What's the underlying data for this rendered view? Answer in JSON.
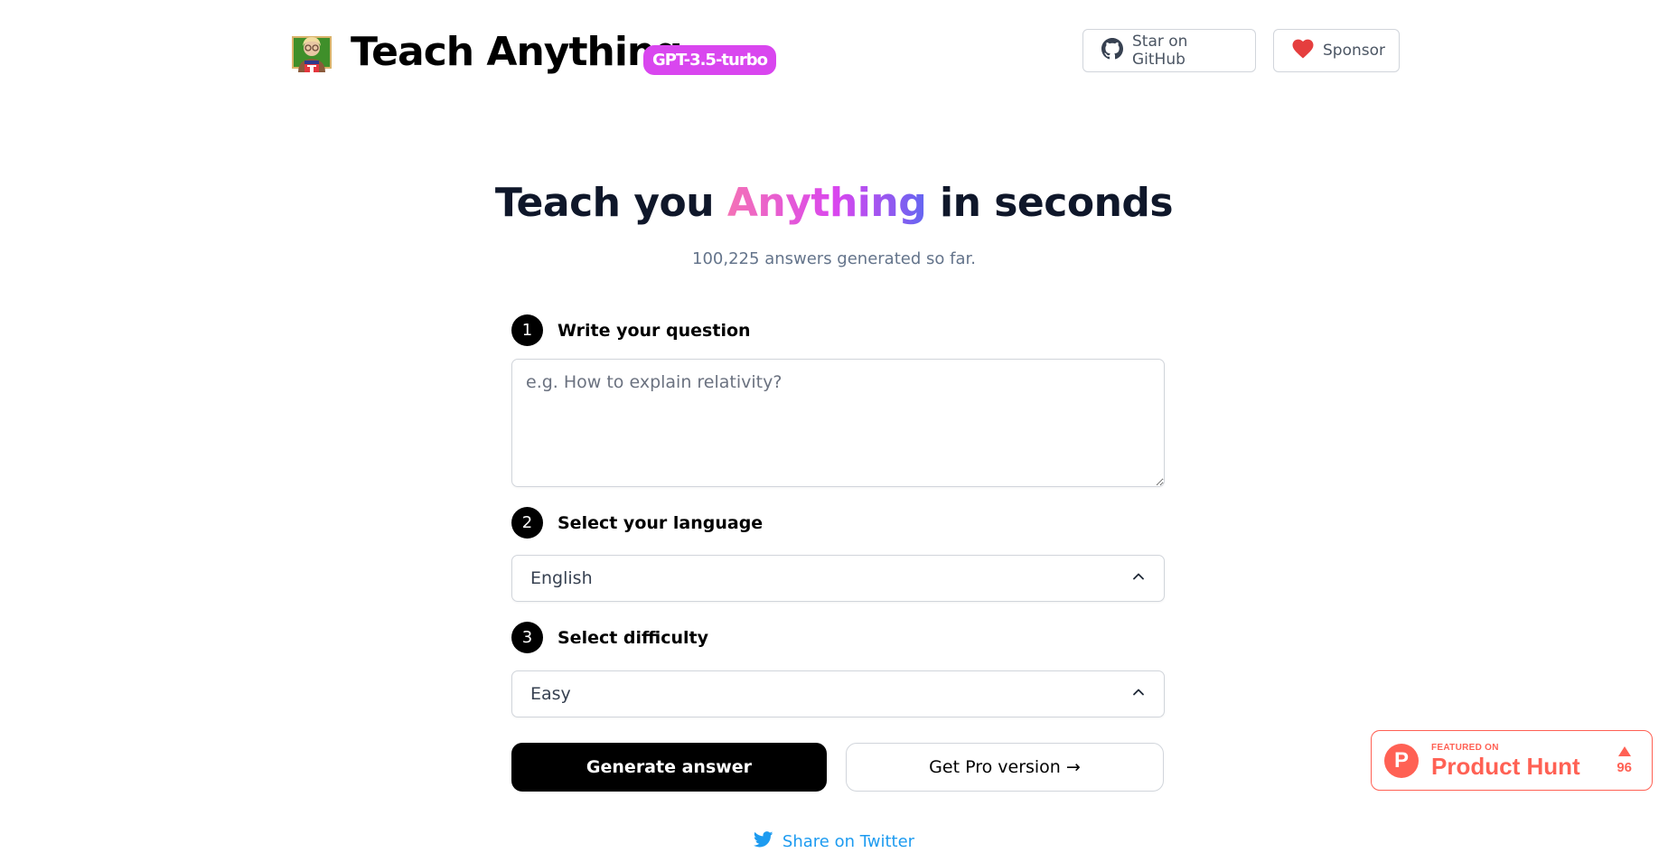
{
  "header": {
    "logo_icon": "teacher-emoji-icon",
    "app_title": "Teach Anything",
    "model_badge": "GPT-3.5-turbo",
    "github_button": {
      "icon": "github-icon",
      "label": "Star on GitHub"
    },
    "sponsor_button": {
      "icon": "heart-icon",
      "label": "Sponsor"
    }
  },
  "hero": {
    "headline_before": "Teach you ",
    "headline_highlight": "Anything",
    "headline_after": " in seconds",
    "subtitle": "100,225 answers generated so far."
  },
  "form": {
    "steps": [
      {
        "number": "1",
        "label": "Write your question"
      },
      {
        "number": "2",
        "label": "Select your language"
      },
      {
        "number": "3",
        "label": "Select difficulty"
      }
    ],
    "question": {
      "value": "",
      "placeholder": "e.g. How to explain relativity?"
    },
    "language_select": {
      "value": "English",
      "icon": "chevron-up-icon"
    },
    "difficulty_select": {
      "value": "Easy",
      "icon": "chevron-up-icon"
    },
    "generate_button": "Generate answer",
    "pro_button": "Get Pro version →"
  },
  "share": {
    "icon": "twitter-icon",
    "label": "Share on Twitter"
  },
  "product_hunt": {
    "small_text": "FEATURED ON",
    "big_text": "Product Hunt",
    "logo_letter": "P",
    "votes": "96"
  },
  "colors": {
    "badge": "#d946ef",
    "gradient_start": "#f472b6",
    "gradient_mid": "#d946ef",
    "gradient_end": "#6366f1",
    "twitter": "#1d9bf0",
    "product_hunt": "#ff6154",
    "heart": "#e53e3e"
  }
}
